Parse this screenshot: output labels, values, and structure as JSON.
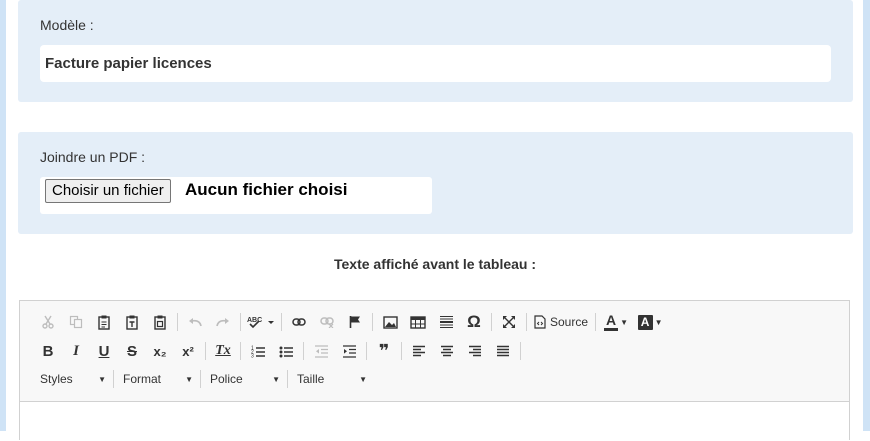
{
  "model_section": {
    "label": "Modèle :",
    "value": "Facture papier licences"
  },
  "pdf_section": {
    "label": "Joindre un PDF :",
    "button_label": "Choisir un fichier",
    "status": "Aucun fichier choisi"
  },
  "editor_caption": "Texte affiché avant le tableau :",
  "editor": {
    "source_label": "Source",
    "styles_label": "Styles",
    "format_label": "Format",
    "font_label": "Police",
    "size_label": "Taille",
    "bold_glyph": "B",
    "italic_glyph": "I",
    "underline_glyph": "U",
    "strike_glyph": "S",
    "subscript_glyph": "x₂",
    "superscript_glyph": "x²",
    "removeformat_glyph": "Tx",
    "blockquote_glyph": "❞",
    "specialchar_glyph": "Ω",
    "textcolor_glyph": "A",
    "bgcolor_glyph": "A"
  },
  "colors": {
    "panel_bg": "#e4eef8",
    "side_bg": "#cfe3f6"
  }
}
